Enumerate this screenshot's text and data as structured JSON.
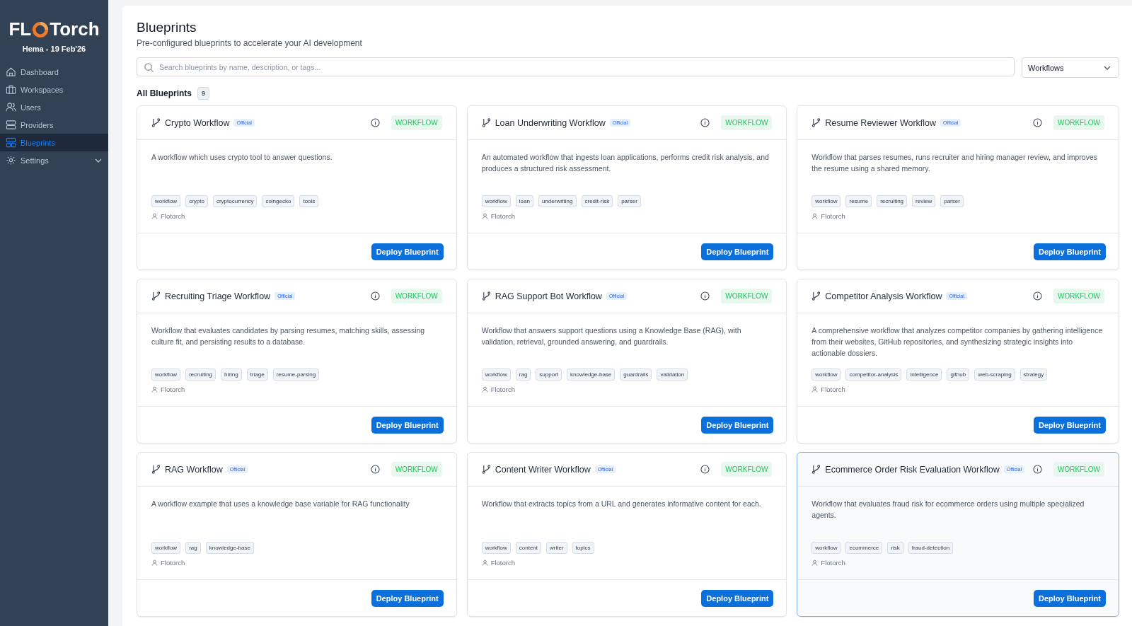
{
  "sidebar": {
    "logo": {
      "left": "FL",
      "right": "Torch"
    },
    "user": "Hema - 19 Feb'26",
    "items": [
      {
        "label": "Dashboard",
        "selected": false
      },
      {
        "label": "Workspaces",
        "selected": false
      },
      {
        "label": "Users",
        "selected": false
      },
      {
        "label": "Providers",
        "selected": false
      },
      {
        "label": "Blueprints",
        "selected": true
      },
      {
        "label": "Settings",
        "selected": false,
        "expanded": false
      }
    ]
  },
  "header": {
    "title": "Blueprints",
    "subtitle": "Pre-configured blueprints to accelerate your AI development"
  },
  "search": {
    "placeholder": "Search blueprints by name, description, or tags..."
  },
  "filter": {
    "value": "Workflows"
  },
  "section": {
    "title": "All Blueprints",
    "count": "9"
  },
  "cards": [
    {
      "title": "Crypto Workflow",
      "badge": "Official",
      "type": "WORKFLOW",
      "description": "A workflow which uses crypto tool to answer questions.",
      "tags": [
        "workflow",
        "crypto",
        "cryptocurrency",
        "coingecko",
        "tools"
      ],
      "author": "Flotorch",
      "button": "Deploy Blueprint",
      "selected": false
    },
    {
      "title": "Loan Underwriting Workflow",
      "badge": "Official",
      "type": "WORKFLOW",
      "description": "An automated workflow that ingests loan applications, performs credit risk analysis, and produces a structured risk assessment.",
      "tags": [
        "workflow",
        "loan",
        "underwriting",
        "credit-risk",
        "parser"
      ],
      "author": "Flotorch",
      "button": "Deploy Blueprint",
      "selected": false
    },
    {
      "title": "Resume Reviewer Workflow",
      "badge": "Official",
      "type": "WORKFLOW",
      "description": "Workflow that parses resumes, runs recruiter and hiring manager review, and improves the resume using a shared memory.",
      "tags": [
        "workflow",
        "resume",
        "recruiting",
        "review",
        "parser"
      ],
      "author": "Flotorch",
      "button": "Deploy Blueprint",
      "selected": false
    },
    {
      "title": "Recruiting Triage Workflow",
      "badge": "Official",
      "type": "WORKFLOW",
      "description": "Workflow that evaluates candidates by parsing resumes, matching skills, assessing culture fit, and persisting results to a database.",
      "tags": [
        "workflow",
        "recruiting",
        "hiring",
        "triage",
        "resume-parsing"
      ],
      "author": "Flotorch",
      "button": "Deploy Blueprint",
      "selected": false
    },
    {
      "title": "RAG Support Bot Workflow",
      "badge": "Official",
      "type": "WORKFLOW",
      "description": "Workflow that answers support questions using a Knowledge Base (RAG), with validation, retrieval, grounded answering, and guardrails.",
      "tags": [
        "workflow",
        "rag",
        "support",
        "knowledge-base",
        "guardrails",
        "validation"
      ],
      "author": "Flotorch",
      "button": "Deploy Blueprint",
      "selected": false
    },
    {
      "title": "Competitor Analysis Workflow",
      "badge": "Official",
      "type": "WORKFLOW",
      "description": "A comprehensive workflow that analyzes competitor companies by gathering intelligence from their websites, GitHub repositories, and synthesizing strategic insights into actionable dossiers.",
      "tags": [
        "workflow",
        "competitor-analysis",
        "intelligence",
        "github",
        "web-scraping",
        "strategy"
      ],
      "author": "Flotorch",
      "button": "Deploy Blueprint",
      "selected": false
    },
    {
      "title": "RAG Workflow",
      "badge": "Official",
      "type": "WORKFLOW",
      "description": "A workflow example that uses a knowledge base variable for RAG functionality",
      "tags": [
        "workflow",
        "rag",
        "knowledge-base"
      ],
      "author": "Flotorch",
      "button": "Deploy Blueprint",
      "selected": false
    },
    {
      "title": "Content Writer Workflow",
      "badge": "Official",
      "type": "WORKFLOW",
      "description": "Workflow that extracts topics from a URL and generates informative content for each.",
      "tags": [
        "workflow",
        "content",
        "writer",
        "topics"
      ],
      "author": "Flotorch",
      "button": "Deploy Blueprint",
      "selected": false
    },
    {
      "title": "Ecommerce Order Risk Evaluation Workflow",
      "badge": "Official",
      "type": "WORKFLOW",
      "description": "Workflow that evaluates fraud risk for ecommerce orders using multiple specialized agents.",
      "tags": [
        "workflow",
        "ecommerce",
        "risk",
        "fraud-detection"
      ],
      "author": "Flotorch",
      "button": "Deploy Blueprint",
      "selected": true
    }
  ]
}
